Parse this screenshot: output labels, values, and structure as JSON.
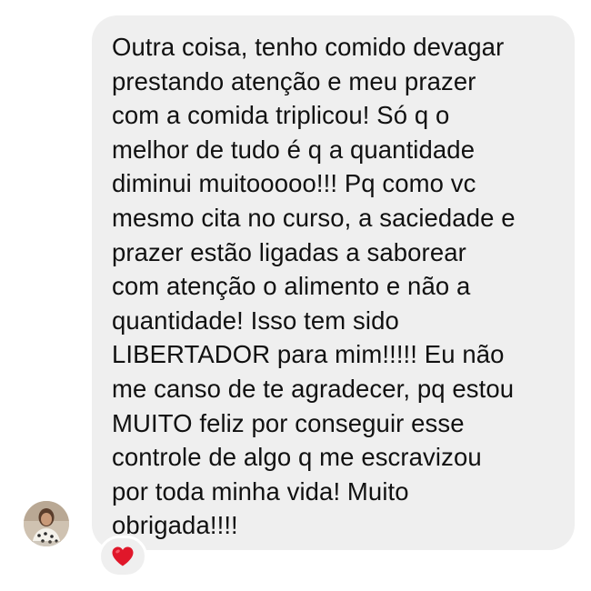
{
  "message": {
    "lines": [
      "Outra coisa, tenho comido devagar",
      "prestando atenção e meu prazer",
      "com a comida triplicou! Só q o",
      "melhor de tudo é q a quantidade",
      "diminui muitooooo!!! Pq como vc",
      "mesmo cita no curso, a saciedade e",
      "prazer estão ligadas a saborear",
      "com atenção o alimento e não a",
      "quantidade! Isso tem sido",
      "LIBERTADOR para mim!!!!! Eu não",
      "me canso de te agradecer, pq estou",
      "MUITO feliz por conseguir esse",
      "controle de algo q me escravizou",
      "por toda minha vida! Muito",
      "obrigada!!!!"
    ],
    "bubble_color": "#efefef",
    "text_color": "#111111"
  },
  "sender": {
    "avatar_icon": "profile-photo"
  },
  "reaction": {
    "icon": "red-heart-icon",
    "color": "#e0172a"
  }
}
